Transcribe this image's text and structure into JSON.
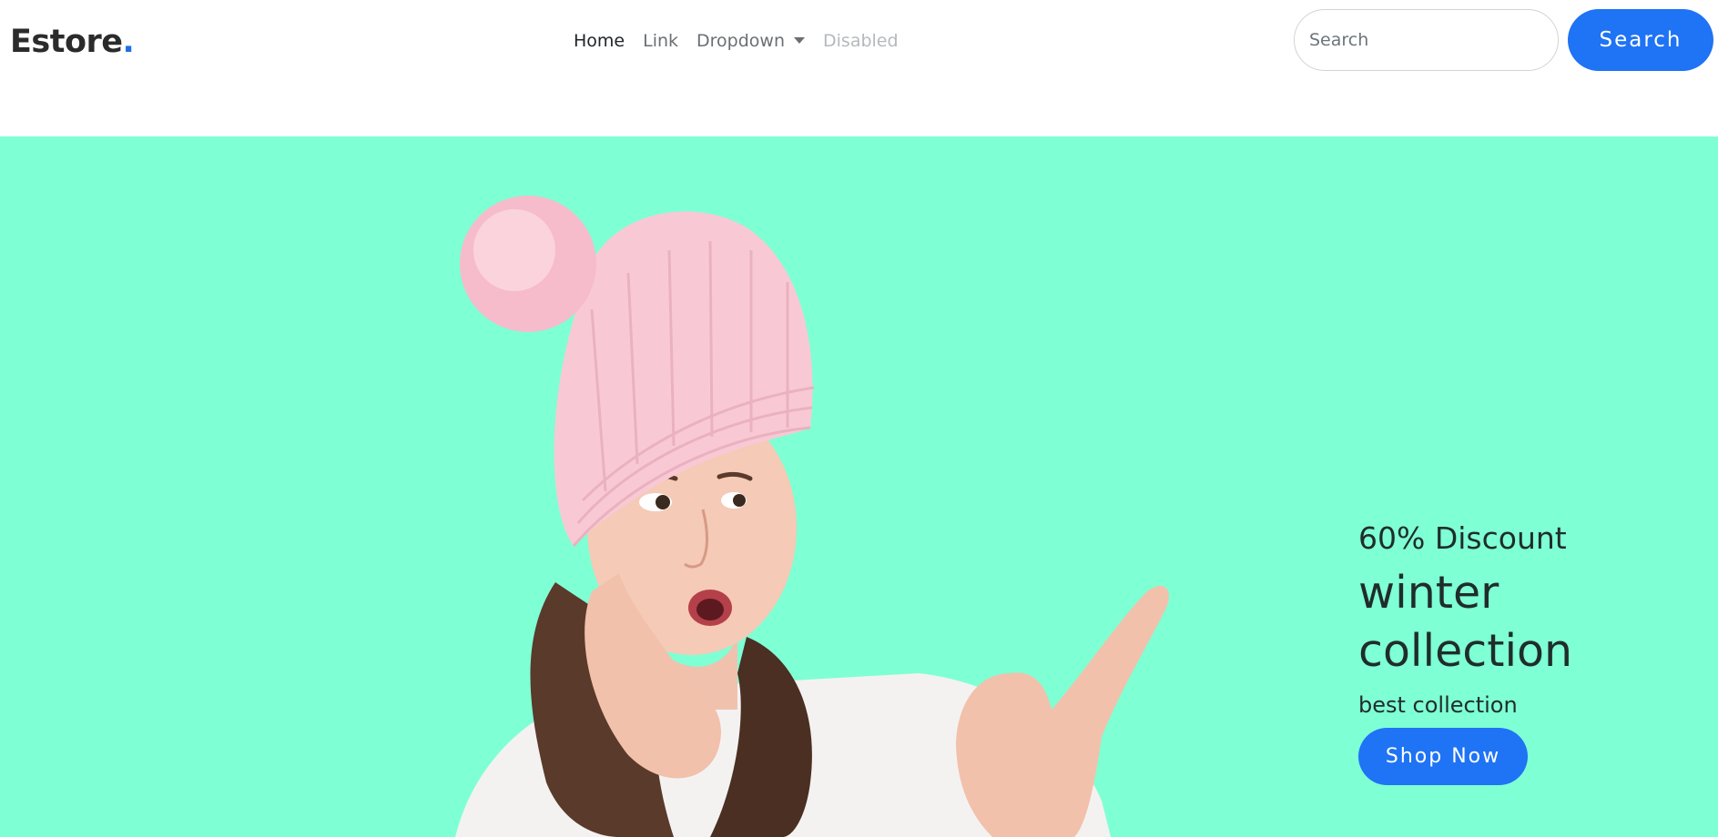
{
  "brand": {
    "name": "Estore",
    "dot": "."
  },
  "nav": {
    "items": [
      {
        "label": "Home",
        "state": "active"
      },
      {
        "label": "Link",
        "state": "normal"
      },
      {
        "label": "Dropdown",
        "state": "dropdown"
      },
      {
        "label": "Disabled",
        "state": "disabled"
      }
    ]
  },
  "search": {
    "placeholder": "Search",
    "button_label": "Search"
  },
  "hero": {
    "discount": "60% Discount",
    "title": "winter collection",
    "subtitle": "best collection",
    "cta_label": "Shop Now",
    "image_subject": "girl-in-pink-knit-beanie-pointing"
  },
  "colors": {
    "accent": "#1f73f5",
    "brand_dot": "#1f6feb",
    "hero_background": "#7fffd4",
    "text_dark": "#1f2d2a"
  }
}
